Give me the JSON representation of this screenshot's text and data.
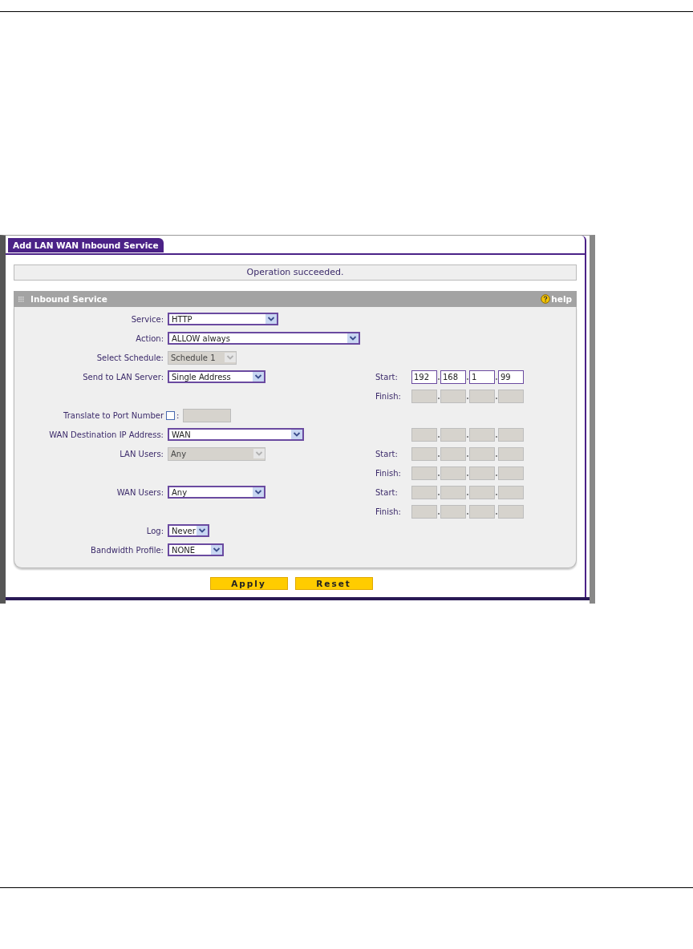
{
  "tab": {
    "label": "Add LAN WAN Inbound Service",
    "selected": true
  },
  "message": "Operation succeeded.",
  "section": {
    "title": "Inbound Service",
    "help": "help"
  },
  "rows": [
    {
      "label": "Service:",
      "control": {
        "kind": "select",
        "value": "HTTP",
        "disabled": false
      }
    },
    {
      "label": "Action:",
      "control": {
        "kind": "select",
        "value": "ALLOW always",
        "disabled": false
      }
    },
    {
      "label": "Select Schedule:",
      "control": {
        "kind": "select",
        "value": "Schedule 1",
        "disabled": true
      }
    },
    {
      "label": "Send to LAN Server:",
      "control": {
        "kind": "select",
        "value": "Single Address",
        "disabled": false
      },
      "address": {
        "label": "Start:",
        "octets": [
          "192",
          "168",
          "1",
          "99"
        ],
        "disabled": false
      }
    },
    {
      "address": {
        "label": "Finish:",
        "disabled": true
      }
    },
    {
      "label": "Translate to Port Number",
      "control": {
        "kind": "port",
        "checked": false,
        "separator": ":",
        "disabled": true
      }
    },
    {
      "label": "WAN Destination IP Address:",
      "control": {
        "kind": "select",
        "value": "WAN",
        "disabled": false
      },
      "address": {
        "disabled": true
      }
    },
    {
      "label": "LAN Users:",
      "control": {
        "kind": "select",
        "value": "Any",
        "disabled": true
      },
      "address": {
        "label": "Start:",
        "disabled": true
      }
    },
    {
      "address": {
        "label": "Finish:",
        "disabled": true
      }
    },
    {
      "label": "WAN Users:",
      "control": {
        "kind": "select",
        "value": "Any",
        "disabled": false
      },
      "address": {
        "label": "Start:",
        "disabled": true
      }
    },
    {
      "address": {
        "label": "Finish:",
        "disabled": true
      }
    },
    {
      "label": "Log:",
      "control": {
        "kind": "select",
        "value": "Never",
        "disabled": false
      }
    },
    {
      "label": "Bandwidth Profile:",
      "control": {
        "kind": "select",
        "value": "NONE",
        "disabled": false
      }
    }
  ],
  "buttons": [
    "Apply",
    "Reset"
  ]
}
